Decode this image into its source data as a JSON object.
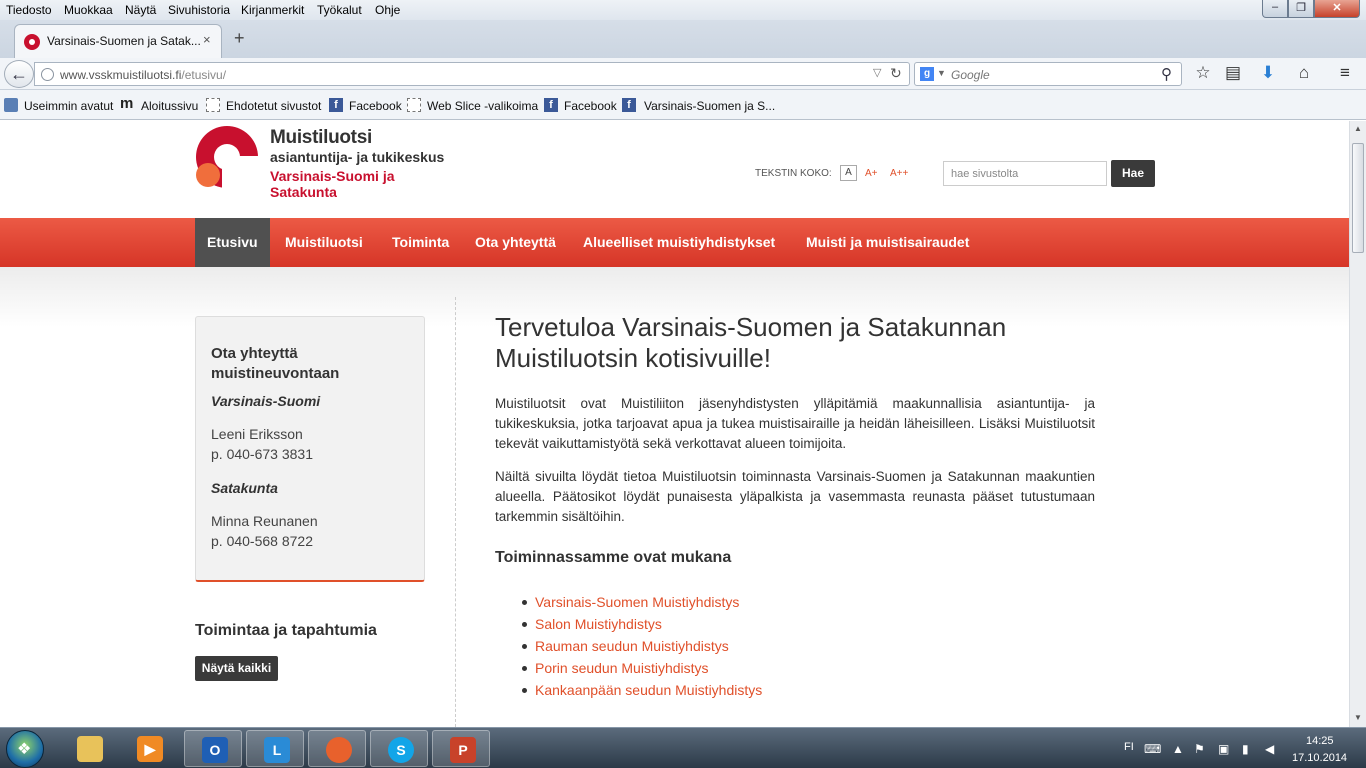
{
  "browser": {
    "menu": [
      "Tiedosto",
      "Muokkaa",
      "Näytä",
      "Sivuhistoria",
      "Kirjanmerkit",
      "Työkalut",
      "Ohje"
    ],
    "tab": {
      "title": "Varsinais-Suomen ja Satak...",
      "close": "×"
    },
    "new_tab": "+",
    "url": {
      "domain": "www.vsskmuistiluotsi.fi",
      "path": "/etusivu/"
    },
    "search": {
      "engine": "g",
      "placeholder": "Google"
    },
    "bookmarks": [
      "Useimmin avatut",
      "Aloitussivu",
      "Ehdotetut sivustot",
      "Facebook",
      "Web Slice -valikoima",
      "Facebook",
      "Varsinais-Suomen ja S..."
    ]
  },
  "site": {
    "logo": {
      "line1": "Muistiluotsi",
      "line2": "asiantuntija- ja tukikeskus",
      "line3": "Varsinais-Suomi ja Satakunta"
    },
    "text_size": {
      "label": "TEKSTIN KOKO:",
      "options": [
        "A",
        "A+",
        "A++"
      ]
    },
    "search": {
      "placeholder": "hae sivustolta",
      "button": "Hae"
    },
    "nav": [
      "Etusivu",
      "Muistiluotsi",
      "Toiminta",
      "Ota yhteyttä",
      "Alueelliset muistiyhdistykset",
      "Muisti ja muistisairaudet"
    ],
    "contact": {
      "title": "Ota yhteyttä muistineuvontaan",
      "regions": [
        {
          "name": "Varsinais-Suomi",
          "person": "Leeni Eriksson",
          "phone": "p. 040-673 3831"
        },
        {
          "name": "Satakunta",
          "person": "Minna Reunanen",
          "phone": "p. 040-568 8722"
        }
      ]
    },
    "events": {
      "title": "Toimintaa ja tapahtumia",
      "button": "Näytä kaikki"
    },
    "main": {
      "title": "Tervetuloa Varsinais-Suomen ja Satakunnan Muistiluotsin kotisivuille!",
      "paragraphs": [
        "Muistiluotsit ovat Muistiliiton jäsenyhdistysten ylläpitämiä maakunnallisia asiantuntija- ja tukikeskuksia, jotka tarjoavat apua ja tukea muistisairaille ja heidän läheisilleen. Lisäksi Muistiluotsit tekevät vaikuttamistyötä sekä verkottavat alueen toimijoita.",
        "Näiltä sivuilta löydät tietoa Muistiluotsin toiminnasta Varsinais-Suomen ja Satakunnan maakuntien alueella. Päätosikot löydät punaisesta yläpalkista ja vasemmasta reunasta pääset tutustumaan tarkemmin sisältöihin."
      ],
      "subhead": "Toiminnassamme ovat mukana",
      "members": [
        "Varsinais-Suomen Muistiyhdistys",
        "Salon Muistiyhdistys",
        "Rauman seudun Muistiyhdistys",
        "Porin seudun Muistiyhdistys",
        "Kankaanpään seudun Muistiyhdistys"
      ]
    }
  },
  "taskbar": {
    "lang": "FI",
    "time": "14:25",
    "date": "17.10.2014"
  },
  "colors": {
    "accent": "#e0502a",
    "nav_red": "#d63527",
    "brand": "#c8102e"
  }
}
